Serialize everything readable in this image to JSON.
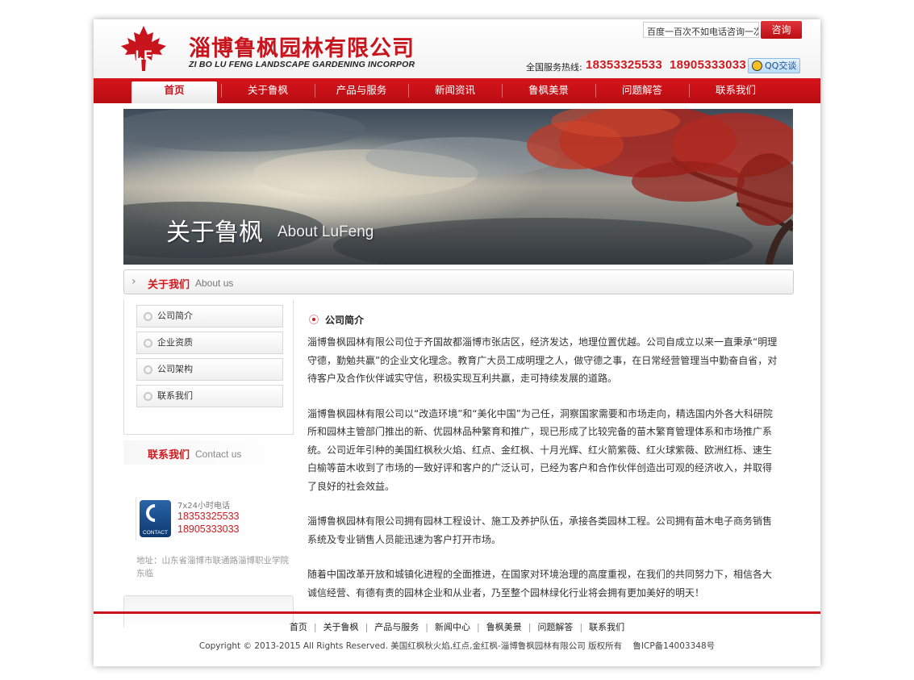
{
  "header": {
    "company_name_cn": "淄博鲁枫园林有限公司",
    "company_name_en": "ZI BO LU FENG LANDSCAPE GARDENING INCORPOR",
    "logo_letters": "LF",
    "search_value": "百度一百次不如电话咨询一次",
    "search_button": "咨询",
    "hotline_label": "全国服务热线:",
    "hotline_numbers": "18353325533  18905333033",
    "qq_button": "QQ交谈"
  },
  "nav": {
    "items": [
      "首页",
      "关于鲁枫",
      "产品与服务",
      "新闻资讯",
      "鲁枫美景",
      "问题解答",
      "联系我们"
    ],
    "active_index": 0
  },
  "banner": {
    "title_cn": "关于鲁枫",
    "title_en": "About LuFeng"
  },
  "section_bar": {
    "title": "关于我们",
    "subtitle": "About us"
  },
  "sidebar": {
    "items": [
      "公司简介",
      "企业资质",
      "公司架构",
      "联系我们"
    ],
    "contact_title": "联系我们",
    "contact_subtitle": "Contact us",
    "phone_label": "CONTACT",
    "hours": "7x24小时电话",
    "phone1": "18353325533",
    "phone2": "18905333033",
    "address": "地址：山东省淄博市联通路淄博职业学院东临"
  },
  "content": {
    "title": "公司简介",
    "paragraphs": [
      "淄博鲁枫园林有限公司位于齐国故都淄博市张店区，经济发达，地理位置优越。公司自成立以来一直秉承“明理守德，勤勉共赢”的企业文化理念。教育广大员工成明理之人，做守德之事，在日常经营管理当中勤奋自省，对待客户及合作伙伴诚实守信，积极实现互利共赢，走可持续发展的道路。",
      "淄博鲁枫园林有限公司以“改造环境”和“美化中国”为己任，洞察国家需要和市场走向，精选国内外各大科研院所和园林主管部门推出的新、优园林品种繁育和推广，现已形成了比较完备的苗木繁育管理体系和市场推广系统。公司近年引种的美国红枫秋火焰、红点、金红枫、十月光辉、红火箭紫薇、红火球紫薇、欧洲红栎、速生白榆等苗木收到了市场的一致好评和客户的广泛认可，已经为客户和合作伙伴创造出可观的经济收入，并取得了良好的社会效益。",
      "淄博鲁枫园林有限公司拥有园林工程设计、施工及养护队伍，承接各类园林工程。公司拥有苗木电子商务销售系统及专业销售人员能迅速为客户打开市场。",
      "随着中国改革开放和城镇化进程的全面推进，在国家对环境治理的高度重视，在我们的共同努力下，相信各大诚信经营、有德有责的园林企业和从业者，乃至整个园林绿化行业将会拥有更加美好的明天！"
    ]
  },
  "footer": {
    "links": [
      "首页",
      "关于鲁枫",
      "产品与服务",
      "新闻中心",
      "鲁枫美景",
      "问题解答",
      "联系我们"
    ],
    "copyright": "Copyright © 2013-2015 All Rights Reserved. 美国红枫秋火焰,红点,金红枫-淄博鲁枫园林有限公司 版权所有    鲁ICP备14003348号"
  },
  "colors": {
    "brand_red": "#c8141c",
    "nav_red": "#d7141b"
  }
}
